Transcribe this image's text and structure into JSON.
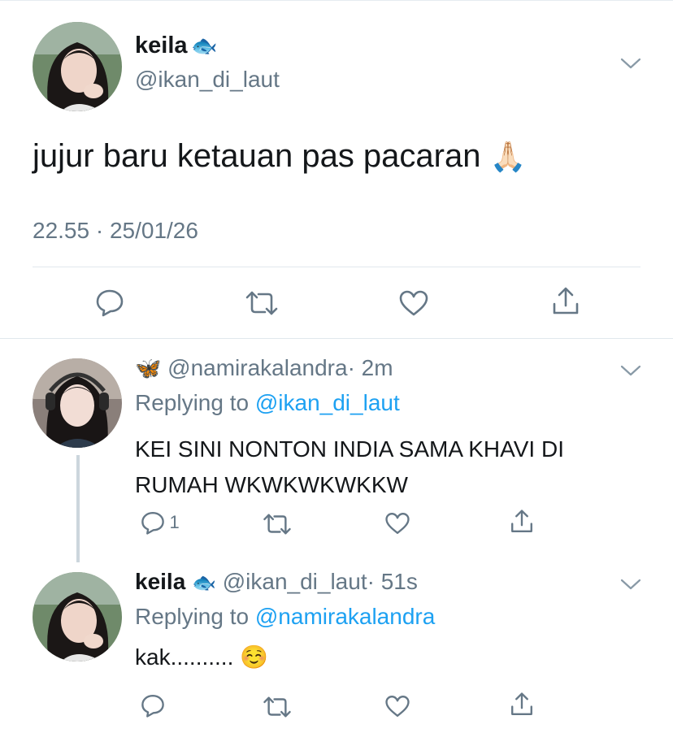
{
  "main_tweet": {
    "display_name": "keila",
    "name_emoji": "🐟",
    "handle": "@ikan_di_laut",
    "text": "jujur baru ketauan pas pacaran",
    "text_emoji": "🙏🏻",
    "timestamp": "22.55 · 25/01/26"
  },
  "replies": [
    {
      "name_emoji": "🦋",
      "handle": "@namirakalandra",
      "time": "· 2m",
      "replying_prefix": "Replying to",
      "replying_to": "@ikan_di_laut",
      "text_line1": "KEI SINI NONTON INDIA SAMA KHAVI DI",
      "text_line2": "RUMAH WKWKWKWKKW",
      "reply_count": "1"
    },
    {
      "display_name": "keila",
      "name_emoji": "🐟",
      "handle": "@ikan_di_laut",
      "time": "· 51s",
      "replying_prefix": "Replying to",
      "replying_to": "@namirakalandra",
      "text": "kak..........",
      "text_emoji": "☺️"
    }
  ],
  "icons": [
    "reply-icon",
    "retweet-icon",
    "like-icon",
    "share-icon",
    "chevron-down-icon"
  ],
  "colors": {
    "accent": "#1da1f2",
    "secondary_text": "#657786",
    "divider": "#e1e8ed"
  }
}
